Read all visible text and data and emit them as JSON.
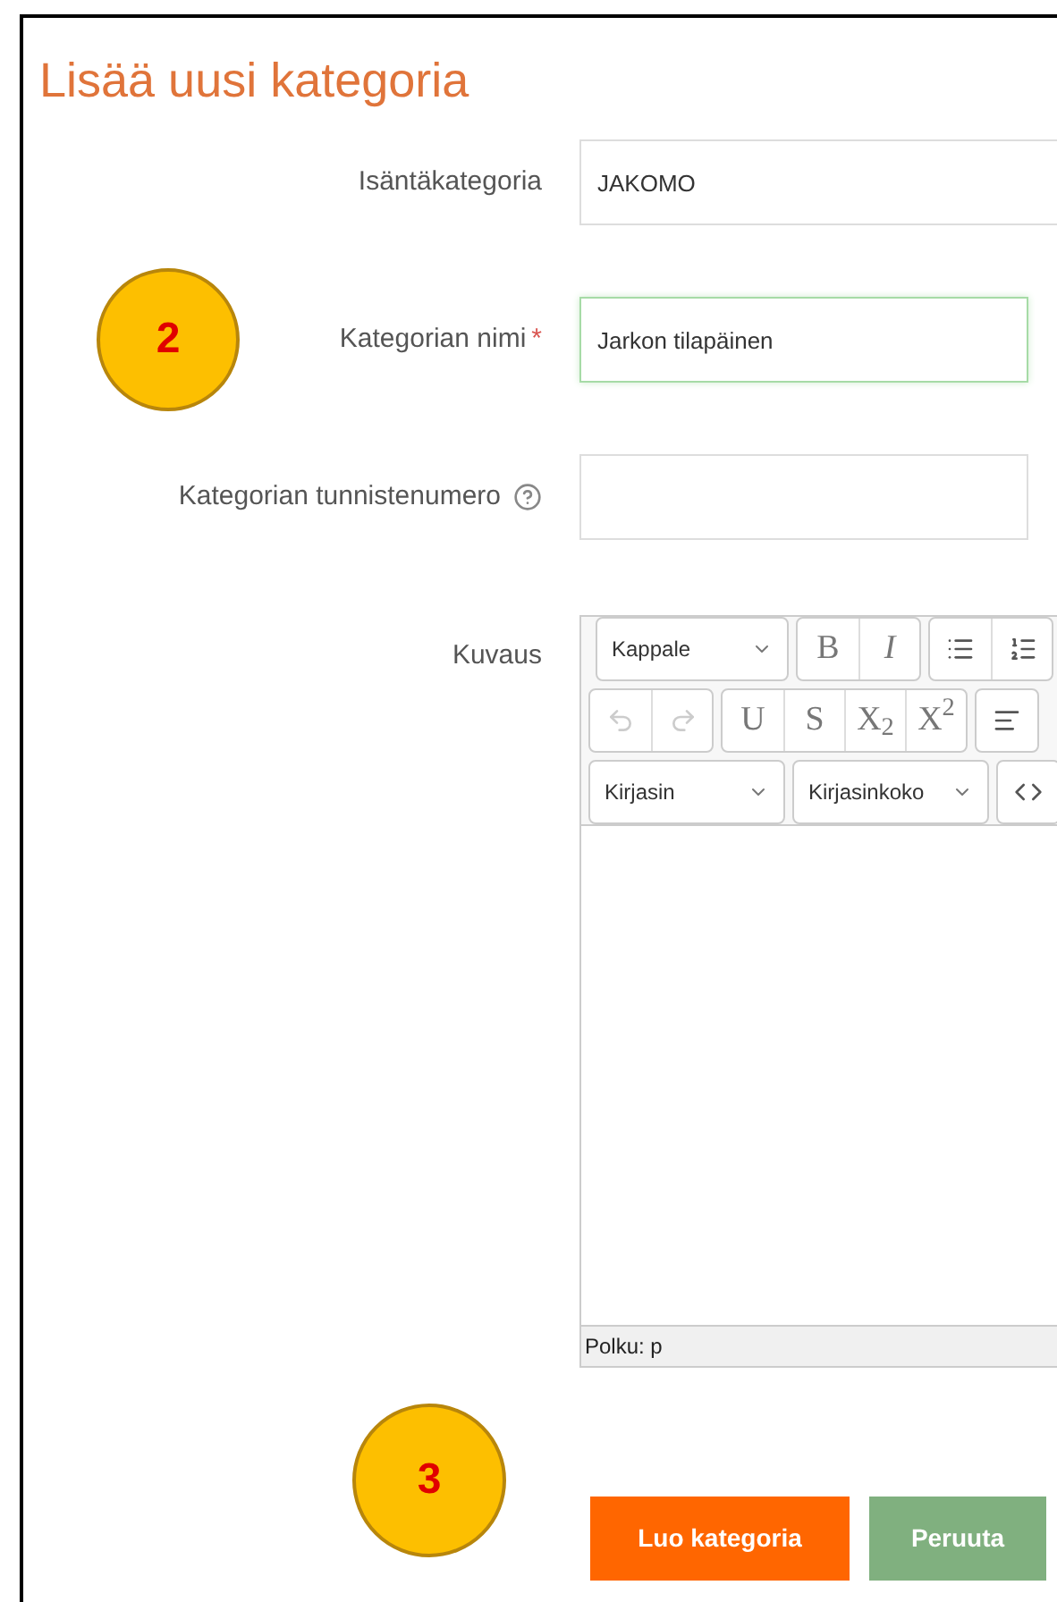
{
  "title": "Lisää uusi kategoria",
  "fields": [
    {
      "label": "Isäntäkategoria",
      "kind": "select",
      "value": "JAKOMO",
      "focused": false
    },
    {
      "label": "Kategorian nimi",
      "required_mark": "*",
      "kind": "text",
      "value": "Jarkon tilapäinen",
      "focused": true
    },
    {
      "label": "Kategorian tunnistenumero",
      "kind": "text",
      "help": true,
      "focused": false
    }
  ],
  "editor": {
    "label": "Kuvaus",
    "toolbar_rows": [
      [
        {
          "kind": "dropdown",
          "label": "Kappale"
        },
        {
          "kind": "group",
          "items": [
            {
              "kind": "text",
              "label": "B"
            },
            {
              "kind": "text",
              "label": "*I*"
            }
          ]
        },
        {
          "kind": "group",
          "items": [
            {
              "kind": "bullets"
            },
            {
              "kind": "numbers"
            }
          ]
        }
      ],
      [
        {
          "kind": "group",
          "items": [
            {
              "kind": "undo",
              "disabled": true
            },
            {
              "kind": "redo",
              "disabled": true
            }
          ]
        },
        {
          "kind": "group",
          "items": [
            {
              "kind": "text",
              "label": "U"
            },
            {
              "kind": "text",
              "label": "S"
            },
            {
              "kind": "text",
              "label": "X$_{2}$"
            },
            {
              "kind": "text",
              "label": "X$^{2}$"
            }
          ]
        },
        {
          "kind": "group",
          "items": [
            {
              "kind": "align"
            }
          ]
        }
      ],
      [
        {
          "kind": "dropdown",
          "label": "Kirjasin"
        },
        {
          "kind": "dropdown",
          "label": "Kirjasinkoko"
        },
        {
          "kind": "group",
          "items": [
            {
              "kind": "code"
            }
          ]
        }
      ]
    ],
    "status": "Polku: p"
  },
  "buttons": [
    {
      "label": "Luo kategoria",
      "kind": "primary"
    },
    {
      "label": "Peruuta",
      "kind": "secondary"
    }
  ],
  "callouts": [
    {
      "number": "2"
    },
    {
      "number": "3"
    }
  ]
}
